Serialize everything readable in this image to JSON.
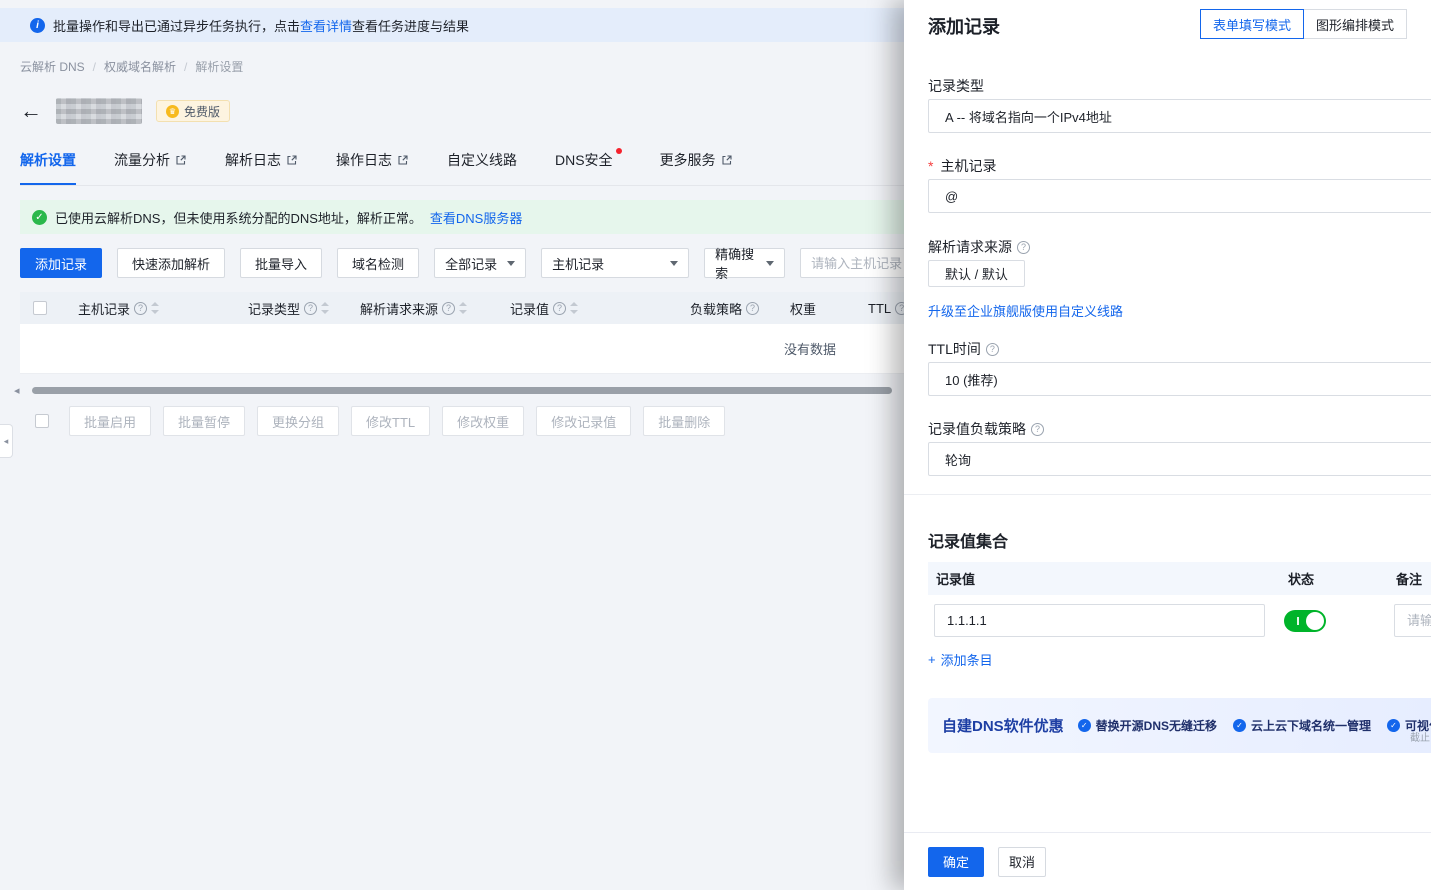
{
  "colors": {
    "accent": "#1366ec",
    "toggle_on": "#00b42a",
    "danger": "#f53f3f",
    "success": "#2bb84b"
  },
  "icons": {
    "info": "i",
    "help": "?",
    "check": "✓",
    "plus": "+",
    "back": "←",
    "crown": "♛",
    "scroll_left": "◂",
    "panel_collapse": "◂"
  },
  "notice": {
    "text_prefix": "批量操作和导出已通过异步任务执行，点击",
    "link": "查看详情",
    "text_suffix": "查看任务进度与结果"
  },
  "breadcrumb": {
    "items": [
      "云解析 DNS",
      "权威域名解析",
      "解析设置"
    ],
    "separator": "/"
  },
  "domain": {
    "badge": "免费版"
  },
  "tabs": [
    {
      "label": "解析设置"
    },
    {
      "label": "流量分析"
    },
    {
      "label": "解析日志"
    },
    {
      "label": "操作日志"
    },
    {
      "label": "自定义线路"
    },
    {
      "label": "DNS安全"
    },
    {
      "label": "更多服务"
    }
  ],
  "status": {
    "text": "已使用云解析DNS，但未使用系统分配的DNS地址，解析正常。",
    "link": "查看DNS服务器"
  },
  "toolbar": {
    "add": "添加记录",
    "quick": "快速添加解析",
    "import": "批量导入",
    "check": "域名检测",
    "type_filter": "全部记录",
    "host_filter": "主机记录",
    "search_mode": "精确搜索",
    "search_placeholder": "请输入主机记录"
  },
  "table": {
    "columns": [
      {
        "label": "主机记录"
      },
      {
        "label": "记录类型"
      },
      {
        "label": "解析请求来源"
      },
      {
        "label": "记录值"
      },
      {
        "label": "负载策略"
      },
      {
        "label": "权重"
      },
      {
        "label": "TTL"
      }
    ],
    "empty": "没有数据"
  },
  "batch": {
    "items": [
      "批量启用",
      "批量暂停",
      "更换分组",
      "修改TTL",
      "修改权重",
      "修改记录值",
      "批量删除"
    ]
  },
  "drawer": {
    "title": "添加记录",
    "modes": {
      "form": "表单填写模式",
      "graph": "图形编排模式"
    },
    "fields": {
      "record_type_label": "记录类型",
      "record_type_value": "A -- 将域名指向一个IPv4地址",
      "host_label": "主机记录",
      "host_value": "@",
      "line_label": "解析请求来源",
      "line_value": "默认 / 默认",
      "upgrade_link": "升级至企业旗舰版使用自定义线路",
      "ttl_label": "TTL时间",
      "ttl_value": "10 (推荐)",
      "policy_label": "记录值负载策略",
      "policy_value": "轮询"
    },
    "record_set": {
      "title": "记录值集合",
      "columns": [
        "记录值",
        "状态",
        "备注"
      ],
      "rows": [
        {
          "value": "1.1.1.1",
          "remark_placeholder": "请输入备注"
        }
      ],
      "add_label": "添加条目"
    },
    "promo": {
      "title": "自建DNS软件优惠",
      "points": [
        "替换开源DNS无缝迁移",
        "云上云下域名统一管理",
        "可视化运维"
      ],
      "note": "截止"
    },
    "footer": {
      "ok": "确定",
      "cancel": "取消"
    }
  }
}
